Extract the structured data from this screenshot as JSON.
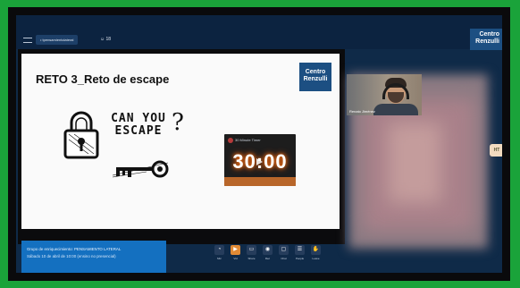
{
  "topbar": {
    "meeting_pill": "• tpensamientolateral",
    "participants": "☺ 18",
    "logo_line1": "Centro",
    "logo_line2": "Renzulli"
  },
  "slide": {
    "title": "RETO 3_Reto de escape",
    "logo_line1": "Centro",
    "logo_line2": "Renzulli",
    "can_you": "CAN YOU",
    "escape": "ESCAPE",
    "question_mark": "?"
  },
  "video": {
    "channel": "30 Minute Timer",
    "timer": "30:00"
  },
  "participant": {
    "name": "Renato Jiménez"
  },
  "side_button": "HT",
  "info": {
    "line1": "Grupo de enriquecimiento: PENSAMIENTO LATERAL",
    "line2": "Sábado 10 de abril de 10:00 (ensino no presencial)"
  },
  "controls": [
    {
      "icon": "◔",
      "label": "Mic"
    },
    {
      "icon": "▶",
      "label": "Vid"
    },
    {
      "icon": "▭",
      "label": "Share"
    },
    {
      "icon": "◉",
      "label": "Rec"
    },
    {
      "icon": "▢",
      "label": "Chat"
    },
    {
      "icon": "☰",
      "label": "People"
    },
    {
      "icon": "✋",
      "label": "Leave"
    }
  ],
  "colors": {
    "border_green": "#1aa33a",
    "brand_blue": "#1c4f82",
    "info_blue": "#1470c0",
    "active_control": "#e08a35"
  }
}
